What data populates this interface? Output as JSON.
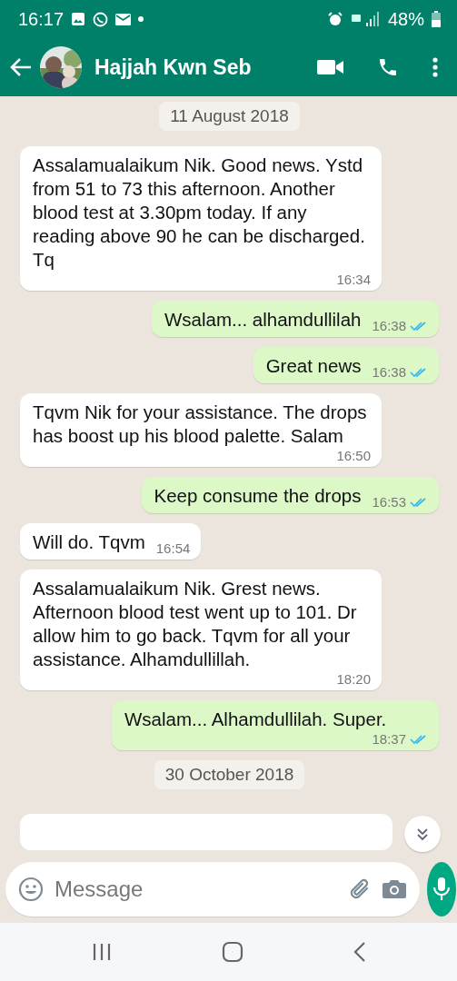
{
  "status_bar": {
    "time": "16:17",
    "battery": "48%"
  },
  "header": {
    "contact_name": "Hajjah Kwn Seb"
  },
  "messages": [
    {
      "kind": "date",
      "text": "11 August 2018"
    },
    {
      "kind": "in",
      "text": "Assalamualaikum Nik. Good news. Ystd from 51 to 73 this afternoon. Another blood test at 3.30pm today. If any reading above 90 he can be discharged. Tq",
      "time": "16:34"
    },
    {
      "kind": "out",
      "text": "Wsalam... alhamdullilah",
      "time": "16:38",
      "read": true
    },
    {
      "kind": "out",
      "text": "Great news",
      "time": "16:38",
      "read": true
    },
    {
      "kind": "in",
      "text": "Tqvm Nik for your assistance. The drops has boost up his blood palette. Salam",
      "time": "16:50"
    },
    {
      "kind": "out",
      "text": "Keep consume the drops",
      "time": "16:53",
      "read": true
    },
    {
      "kind": "in",
      "text": "Will do. Tqvm",
      "time": "16:54"
    },
    {
      "kind": "in",
      "text": "Assalamualaikum Nik. Grest news. Afternoon blood test went up to 101. Dr allow him to go back. Tqvm for all your assistance. Alhamdullillah.",
      "time": "18:20"
    },
    {
      "kind": "out",
      "text": "Wsalam... Alhamdullilah. Super.",
      "time": "18:37",
      "read": true
    },
    {
      "kind": "date",
      "text": "30 October 2018"
    },
    {
      "kind": "in_cut"
    }
  ],
  "composer": {
    "placeholder": "Message"
  }
}
